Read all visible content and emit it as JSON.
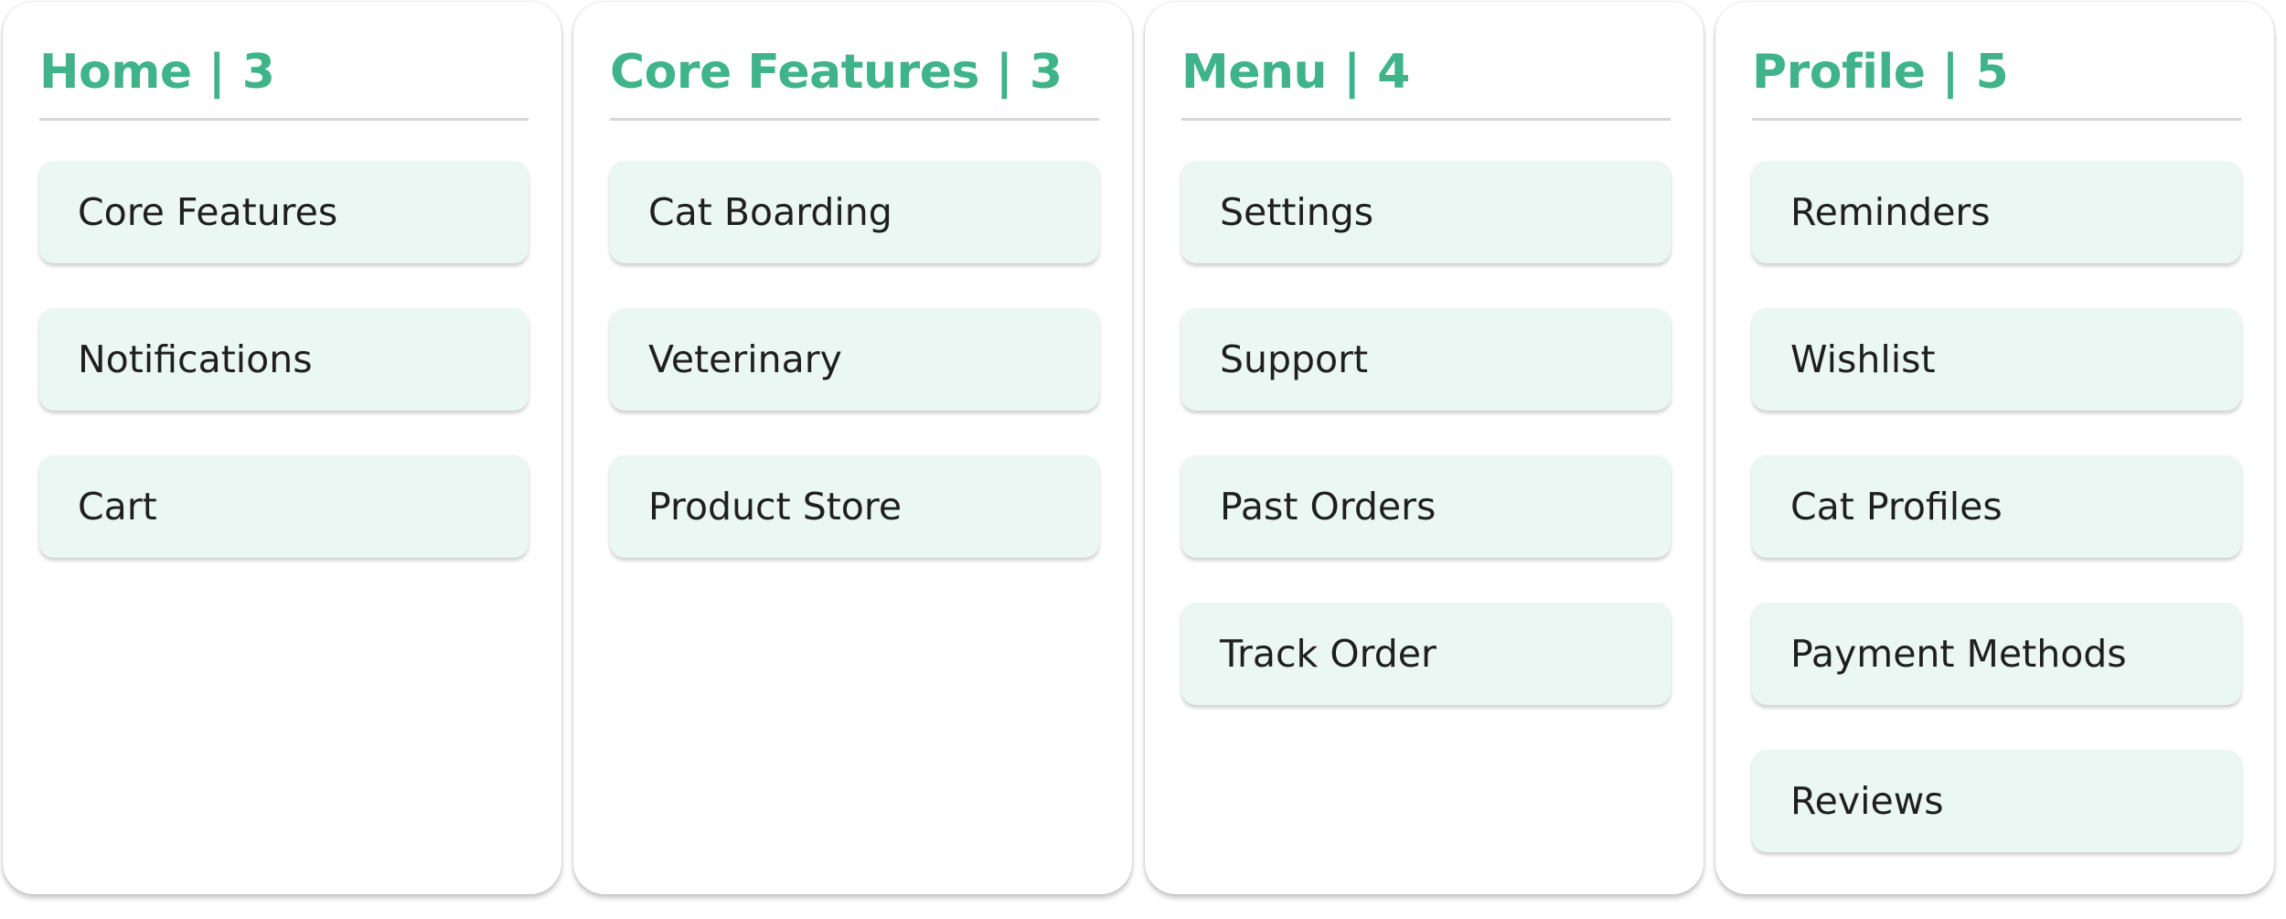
{
  "accent_color": "#3fb38a",
  "card_color": "#ebf7f3",
  "columns": [
    {
      "title": "Home",
      "separator": "|",
      "count": "3",
      "items": [
        {
          "label": "Core Features"
        },
        {
          "label": "Notifications"
        },
        {
          "label": "Cart"
        }
      ]
    },
    {
      "title": "Core Features",
      "separator": "|",
      "count": "3",
      "items": [
        {
          "label": "Cat Boarding"
        },
        {
          "label": "Veterinary"
        },
        {
          "label": "Product Store"
        }
      ]
    },
    {
      "title": "Menu",
      "separator": "|",
      "count": "4",
      "items": [
        {
          "label": "Settings"
        },
        {
          "label": "Support"
        },
        {
          "label": "Past Orders"
        },
        {
          "label": "Track Order"
        }
      ]
    },
    {
      "title": "Profile",
      "separator": "|",
      "count": "5",
      "items": [
        {
          "label": "Reminders"
        },
        {
          "label": "Wishlist"
        },
        {
          "label": "Cat Profiles"
        },
        {
          "label": "Payment Methods"
        },
        {
          "label": "Reviews"
        }
      ]
    }
  ]
}
